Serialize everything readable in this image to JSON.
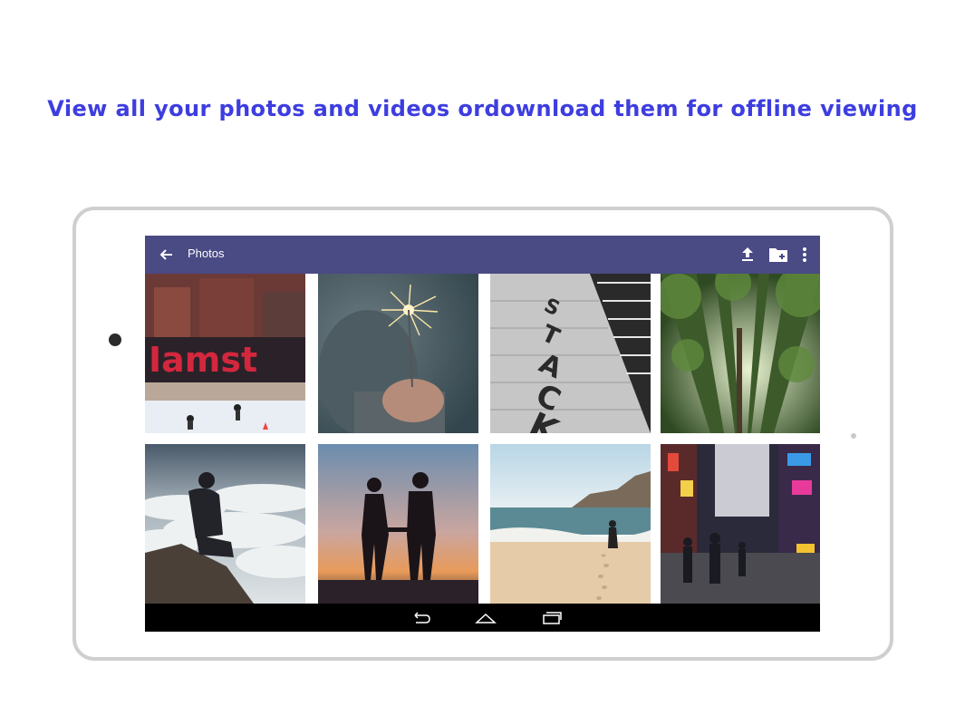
{
  "headline": "View all your photos and videos ordownload them for offline viewing",
  "appbar": {
    "title": "Photos",
    "color": "#4a4a85",
    "icons": [
      "back-arrow-icon",
      "upload-icon",
      "new-folder-icon",
      "more-vert-icon"
    ]
  },
  "photos": [
    {
      "subject": "I amsterdam sign ice rink"
    },
    {
      "subject": "sparkler in hand"
    },
    {
      "subject": "STACK lettering on steps"
    },
    {
      "subject": "bamboo forest"
    },
    {
      "subject": "man on cliff above clouds"
    },
    {
      "subject": "couple silhouette at sunset"
    },
    {
      "subject": "beach with footprints"
    },
    {
      "subject": "city street at night"
    }
  ],
  "navbar": {
    "icons": [
      "nav-back-icon",
      "nav-home-icon",
      "nav-recents-icon"
    ]
  },
  "colors": {
    "headline": "#3d3de0",
    "frame": "#cfcfcf"
  }
}
